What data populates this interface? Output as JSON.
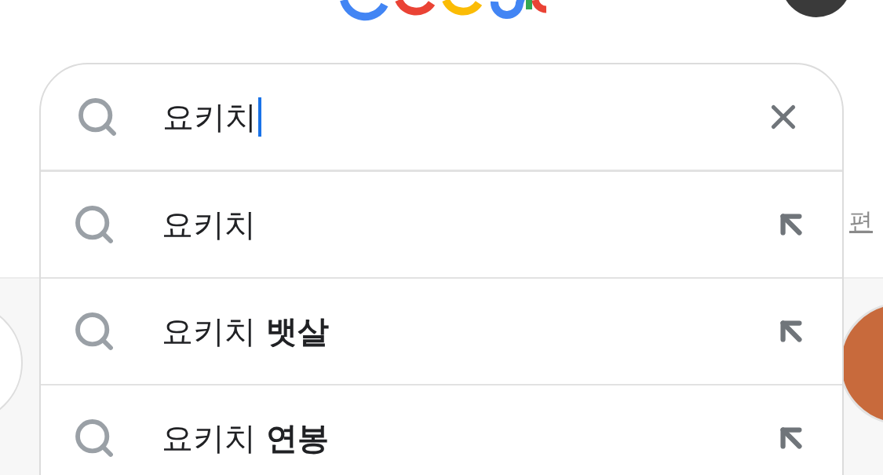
{
  "search": {
    "value": "요키치",
    "focused": true
  },
  "suggestions": [
    {
      "text": "요키치"
    },
    {
      "text": "요키치 **뱃살**"
    },
    {
      "text": "요키치 **연봉**"
    }
  ],
  "side_link": "편"
}
